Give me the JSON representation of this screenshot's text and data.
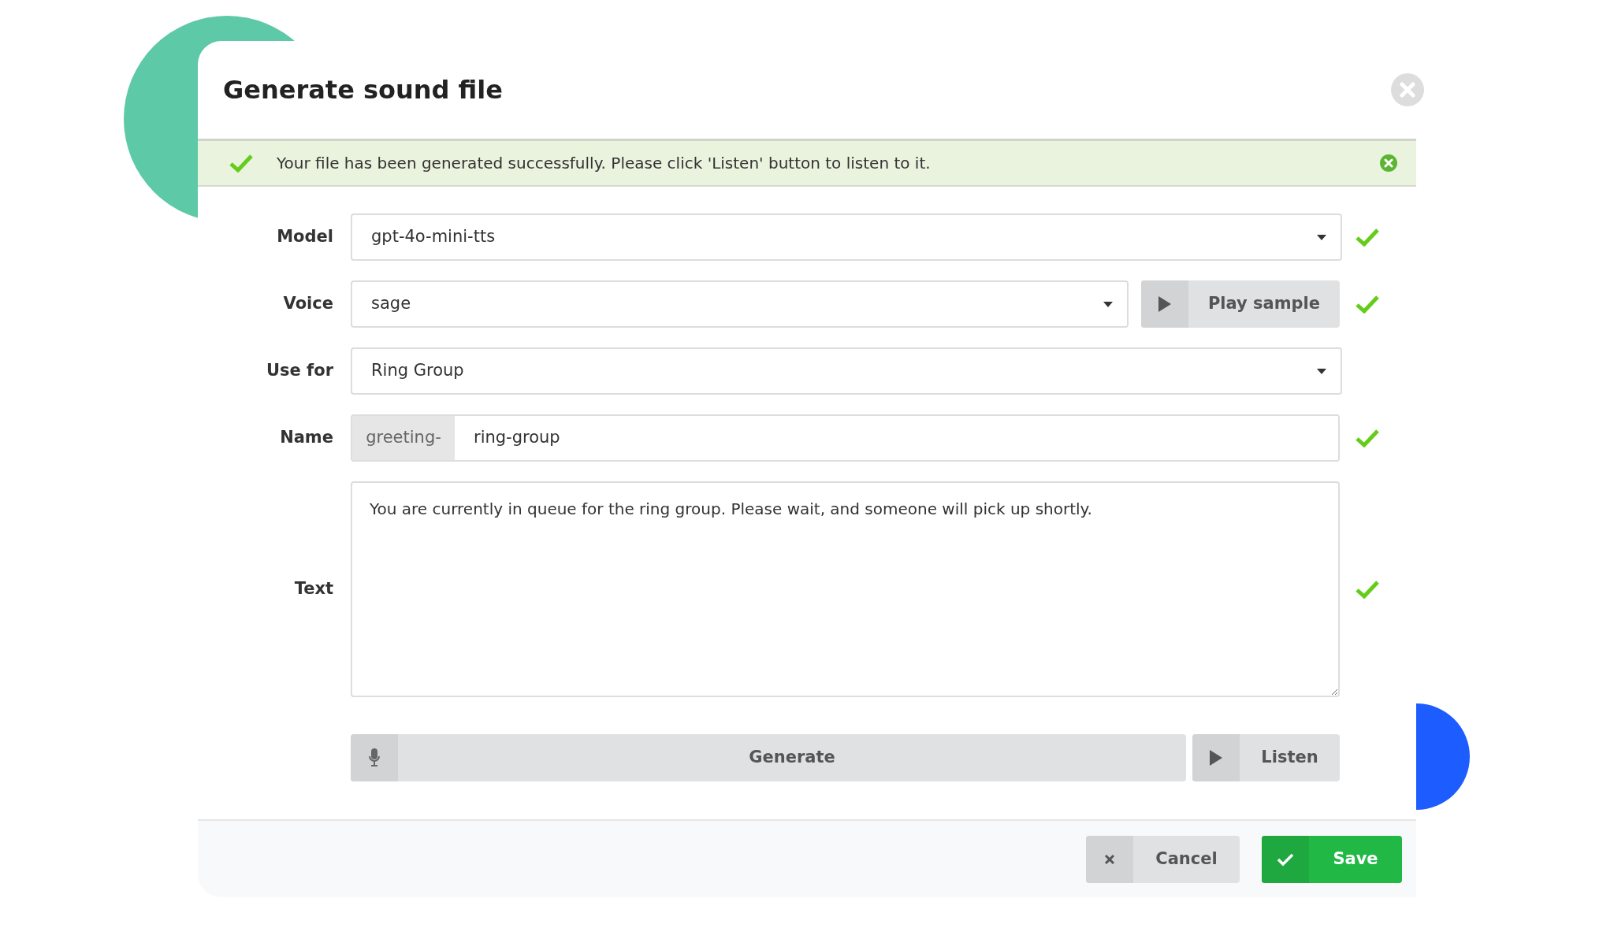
{
  "dialog": {
    "title": "Generate sound file"
  },
  "alert": {
    "message": "Your file has been generated successfully. Please click 'Listen' button to listen to it."
  },
  "fields": [
    {
      "kind": "select",
      "label": "Model",
      "value": "gpt-4o-mini-tts",
      "valid": true
    },
    {
      "kind": "select",
      "label": "Voice",
      "value": "sage",
      "button": "Play sample",
      "valid": true
    },
    {
      "kind": "select",
      "label": "Use for",
      "value": "Ring Group",
      "valid": false
    },
    {
      "kind": "addon",
      "label": "Name",
      "prefix": "greeting-",
      "value": "ring-group",
      "valid": true
    },
    {
      "kind": "textarea",
      "label": "Text",
      "value": "You are currently in queue for the ring group. Please wait, and someone will pick up shortly.",
      "valid": true
    }
  ],
  "actions": {
    "generate": "Generate",
    "listen": "Listen"
  },
  "footer": {
    "cancel": "Cancel",
    "save": "Save"
  }
}
